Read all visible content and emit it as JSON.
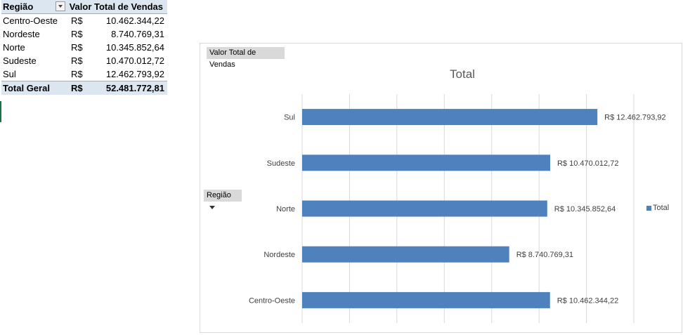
{
  "pivot": {
    "headers": [
      "Região",
      "Valor Total de Vendas"
    ],
    "rows": [
      {
        "region": "Centro-Oeste",
        "currency": "R$",
        "value": "10.462.344,22"
      },
      {
        "region": "Nordeste",
        "currency": "R$",
        "value": "8.740.769,31"
      },
      {
        "region": "Norte",
        "currency": "R$",
        "value": "10.345.852,64"
      },
      {
        "region": "Sudeste",
        "currency": "R$",
        "value": "10.470.012,72"
      },
      {
        "region": "Sul",
        "currency": "R$",
        "value": "12.462.793,92"
      }
    ],
    "total": {
      "label": "Total Geral",
      "currency": "R$",
      "value": "52.481.772,81"
    }
  },
  "chart": {
    "value_field_button": "Valor Total de Vendas",
    "axis_field_button": "Região"
  },
  "chart_data": {
    "type": "bar",
    "orientation": "horizontal",
    "title": "Total",
    "categories": [
      "Centro-Oeste",
      "Nordeste",
      "Norte",
      "Sudeste",
      "Sul"
    ],
    "series": [
      {
        "name": "Total",
        "values": [
          10462344.22,
          8740769.31,
          10345852.64,
          10470012.72,
          12462793.92
        ],
        "color": "#4f81bd"
      }
    ],
    "data_labels": [
      "R$ 10.462.344,22",
      "R$ 8.740.769,31",
      "R$ 10.345.852,64",
      "R$ 10.470.012,72",
      "R$ 12.462.793,92"
    ],
    "xlim": [
      0,
      14000000
    ],
    "grid": true,
    "legend": "right"
  }
}
